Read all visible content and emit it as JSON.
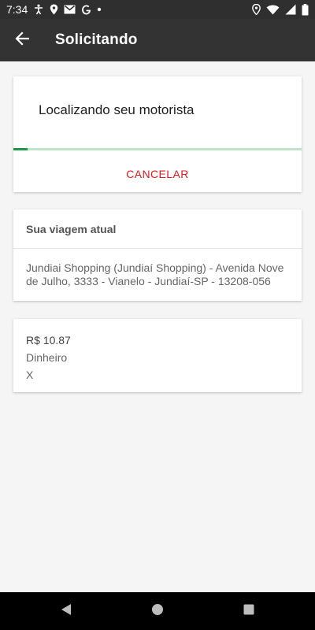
{
  "status_bar": {
    "time": "7:34",
    "icons_left": [
      "accessibility-icon",
      "location-icon",
      "gmail-icon",
      "google-icon",
      "dot-icon"
    ],
    "icons_right": [
      "location-icon",
      "wifi-icon",
      "signal-icon",
      "battery-icon"
    ]
  },
  "app_bar": {
    "title": "Solicitando",
    "back_icon": "arrow-left-icon"
  },
  "search_card": {
    "message": "Localizando seu motorista",
    "progress_fraction": 0.05,
    "cancel_label": "CANCELAR"
  },
  "trip_card": {
    "header": "Sua viagem atual",
    "address": "Jundiai Shopping (Jundiaí Shopping) - Avenida Nove de Julho, 3333 - Vianelo - Jundiaí-SP - 13208-056"
  },
  "payment_card": {
    "price": "R$ 10.87",
    "method": "Dinheiro",
    "extra": "X"
  },
  "nav_bar": {
    "buttons": [
      "back-icon",
      "home-icon",
      "recents-icon"
    ]
  },
  "colors": {
    "app_bar": "#333333",
    "status_bar": "#2f2f2f",
    "progress_track": "#bfe3c9",
    "progress_fill": "#1e9a46",
    "cancel_text": "#e0191b",
    "background": "#f6f5f6"
  }
}
